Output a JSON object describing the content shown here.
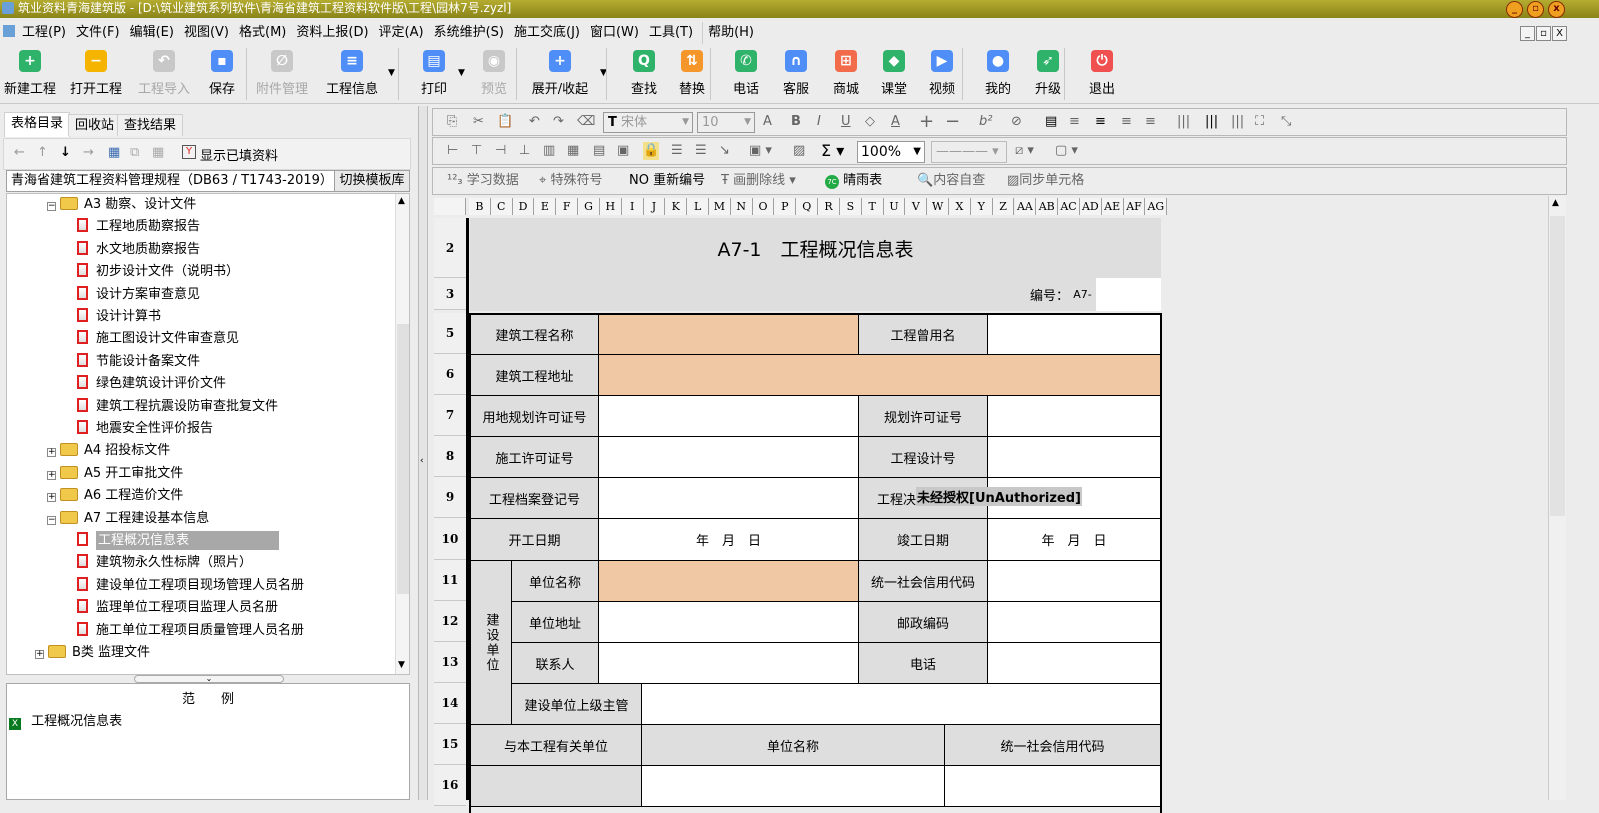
{
  "window": {
    "title": "筑业资料青海建筑版 - [D:\\筑业建筑系列软件\\青海省建筑工程资料软件版\\工程\\园林7号.zyzl]"
  },
  "menu": [
    "工程(P)",
    "文件(F)",
    "编辑(E)",
    "视图(V)",
    "格式(M)",
    "资料上报(D)",
    "评定(A)",
    "系统维护(S)",
    "施工交底(J)",
    "窗口(W)",
    "工具(T)",
    "帮助(H)"
  ],
  "toolbar": [
    {
      "label": "新建工程",
      "icon": "new-project-icon",
      "color": "#2fb36a",
      "glyph": "+",
      "enabled": true
    },
    {
      "label": "打开工程",
      "icon": "open-folder-icon",
      "color": "#f5b400",
      "glyph": "−",
      "enabled": true
    },
    {
      "label": "工程导入",
      "icon": "import-icon",
      "color": "#c8c8c8",
      "glyph": "↶",
      "enabled": false
    },
    {
      "label": "保存",
      "icon": "save-icon",
      "color": "#4f8ef7",
      "glyph": "▪",
      "enabled": true
    },
    {
      "label": "附件管理",
      "icon": "attachment-icon",
      "color": "#c8c8c8",
      "glyph": "∅",
      "enabled": false
    },
    {
      "label": "工程信息",
      "icon": "project-info-icon",
      "color": "#4f8ef7",
      "glyph": "≡",
      "enabled": true
    },
    {
      "label": "打印",
      "icon": "print-icon",
      "color": "#4f8ef7",
      "glyph": "▤",
      "enabled": true
    },
    {
      "label": "预览",
      "icon": "preview-icon",
      "color": "#c8c8c8",
      "glyph": "◉",
      "enabled": false
    },
    {
      "label": "展开/收起",
      "icon": "expand-icon",
      "color": "#4f8ef7",
      "glyph": "+",
      "enabled": true
    },
    {
      "label": "查找",
      "icon": "find-icon",
      "color": "#2fb36a",
      "glyph": "Q",
      "enabled": true
    },
    {
      "label": "替换",
      "icon": "replace-icon",
      "color": "#f5962a",
      "glyph": "⇅",
      "enabled": true
    },
    {
      "label": "电话",
      "icon": "phone-icon",
      "color": "#2fb36a",
      "glyph": "✆",
      "enabled": true
    },
    {
      "label": "客服",
      "icon": "headset-icon",
      "color": "#4f8ef7",
      "glyph": "∩",
      "enabled": true
    },
    {
      "label": "商城",
      "icon": "cart-icon",
      "color": "#f26b4a",
      "glyph": "⊞",
      "enabled": true
    },
    {
      "label": "课堂",
      "icon": "graduation-cap-icon",
      "color": "#2fb36a",
      "glyph": "◆",
      "enabled": true
    },
    {
      "label": "视频",
      "icon": "video-play-icon",
      "color": "#4f8ef7",
      "glyph": "▶",
      "enabled": true
    },
    {
      "label": "我的",
      "icon": "user-icon",
      "color": "#4f8ef7",
      "glyph": "●",
      "enabled": true
    },
    {
      "label": "升级",
      "icon": "rocket-icon",
      "color": "#2fb36a",
      "glyph": "➶",
      "enabled": true
    },
    {
      "label": "退出",
      "icon": "power-icon",
      "color": "#f05050",
      "glyph": "⏻",
      "enabled": true
    }
  ],
  "left": {
    "tabs": [
      "表格目录",
      "回收站",
      "查找结果"
    ],
    "show_filled": "显示已填资料",
    "template": "青海省建筑工程资料管理规程（DB63 / T1743-2019）",
    "switch_button": "切换模板库",
    "tree": [
      {
        "label": "A3 勘察、设计文件",
        "type": "folder",
        "level": 1,
        "expanded": true
      },
      {
        "label": "工程地质勘察报告",
        "type": "doc",
        "level": 2
      },
      {
        "label": "水文地质勘察报告",
        "type": "doc",
        "level": 2
      },
      {
        "label": "初步设计文件（说明书）",
        "type": "doc",
        "level": 2
      },
      {
        "label": "设计方案审查意见",
        "type": "doc",
        "level": 2
      },
      {
        "label": "设计计算书",
        "type": "doc",
        "level": 2
      },
      {
        "label": "施工图设计文件审查意见",
        "type": "doc",
        "level": 2
      },
      {
        "label": "节能设计备案文件",
        "type": "doc",
        "level": 2
      },
      {
        "label": "绿色建筑设计评价文件",
        "type": "doc",
        "level": 2
      },
      {
        "label": "建筑工程抗震设防审查批复文件",
        "type": "doc",
        "level": 2
      },
      {
        "label": "地震安全性评价报告",
        "type": "doc",
        "level": 2
      },
      {
        "label": "A4 招投标文件",
        "type": "folder",
        "level": 1,
        "expanded": false
      },
      {
        "label": "A5 开工审批文件",
        "type": "folder",
        "level": 1,
        "expanded": false
      },
      {
        "label": "A6 工程造价文件",
        "type": "folder",
        "level": 1,
        "expanded": false
      },
      {
        "label": "A7 工程建设基本信息",
        "type": "folder",
        "level": 1,
        "expanded": true
      },
      {
        "label": "工程概况信息表",
        "type": "sheet",
        "level": 2,
        "selected": true
      },
      {
        "label": "建筑物永久性标牌（照片）",
        "type": "doc",
        "level": 2
      },
      {
        "label": "建设单位工程项目现场管理人员名册",
        "type": "doc",
        "level": 2
      },
      {
        "label": "监理单位工程项目监理人员名册",
        "type": "doc",
        "level": 2
      },
      {
        "label": "施工单位工程项目质量管理人员名册",
        "type": "doc",
        "level": 2
      },
      {
        "label": "B类 监理文件",
        "type": "folder",
        "level": 0,
        "expanded": false
      }
    ],
    "legend_title": "范　　例",
    "legend_item": "工程概况信息表"
  },
  "format": {
    "font": "宋体",
    "size": "10",
    "zoom": "100%",
    "row3": [
      "学习数据",
      "特殊符号",
      "重新编号",
      "画删除线",
      "晴雨表",
      "内容自查",
      "同步单元格"
    ]
  },
  "sheet": {
    "columns": [
      "B",
      "C",
      "D",
      "E",
      "F",
      "G",
      "H",
      "I",
      "J",
      "K",
      "L",
      "M",
      "N",
      "O",
      "P",
      "Q",
      "R",
      "S",
      "T",
      "U",
      "V",
      "W",
      "X",
      "Y",
      "Z",
      "AA",
      "AB",
      "AC",
      "AD",
      "AE",
      "AF",
      "AG"
    ],
    "rows": [
      "2",
      "3",
      "5",
      "6",
      "7",
      "8",
      "9",
      "10",
      "11",
      "12",
      "13",
      "14",
      "15",
      "16"
    ],
    "title": "A7-1　工程概况信息表",
    "code_label": "编号：",
    "code_value": "A7-",
    "labels": {
      "name": "建筑工程名称",
      "former": "工程曾用名",
      "addr": "建筑工程地址",
      "land": "用地规划许可证号",
      "plan": "规划许可证号",
      "build": "施工许可证号",
      "design": "工程设计号",
      "archive": "工程档案登记号",
      "decision": "工程决",
      "watermark": "未经授权[UnAuthorized]",
      "start": "开工日期",
      "start_v": "年　月　日",
      "end": "竣工日期",
      "end_v": "年　月　日",
      "owner": "建设单位",
      "uname": "单位名称",
      "credit": "统一社会信用代码",
      "uaddr": "单位地址",
      "post": "邮政编码",
      "contact": "联系人",
      "tel": "电话",
      "superior": "建设单位上级主管",
      "related": "与本工程有关单位",
      "hname": "单位名称",
      "hcredit": "统一社会信用代码"
    }
  }
}
